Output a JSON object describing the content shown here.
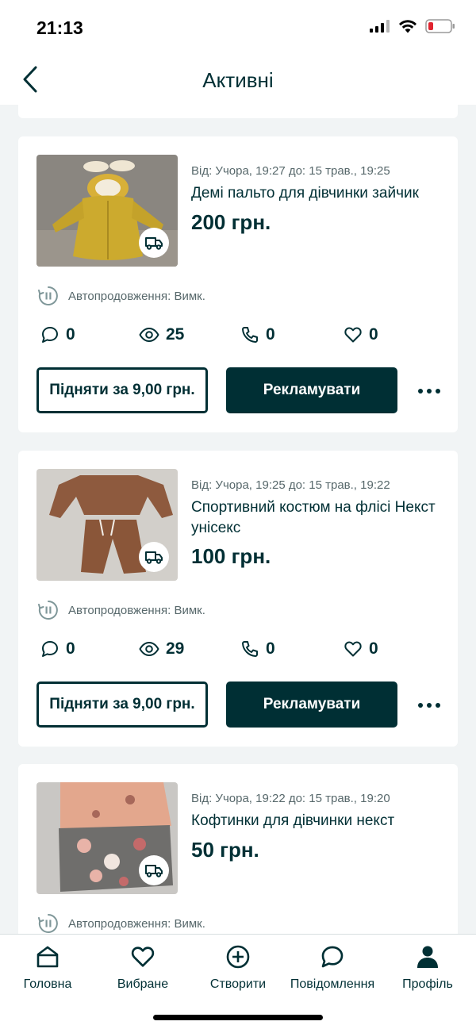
{
  "status_bar": {
    "time": "21:13"
  },
  "header": {
    "title": "Активні"
  },
  "ads": [
    {
      "dates": "Від: Учора, 19:27 до: 15 трав., 19:25",
      "title": "Демі пальто для дівчинки зайчик",
      "price": "200 грн.",
      "autorenew": "Автопродовження: Вимк.",
      "stats": {
        "messages": "0",
        "views": "25",
        "calls": "0",
        "favorites": "0"
      },
      "raise_label": "Підняти за 9,00 грн.",
      "promote_label": "Рекламувати"
    },
    {
      "dates": "Від: Учора, 19:25 до: 15 трав., 19:22",
      "title": "Спортивний костюм на флісі Некст унісекс",
      "price": "100 грн.",
      "autorenew": "Автопродовження: Вимк.",
      "stats": {
        "messages": "0",
        "views": "29",
        "calls": "0",
        "favorites": "0"
      },
      "raise_label": "Підняти за 9,00 грн.",
      "promote_label": "Рекламувати"
    },
    {
      "dates": "Від: Учора, 19:22 до: 15 трав., 19:20",
      "title": "Кофтинки для дівчинки некст",
      "price": "50 грн.",
      "autorenew": "Автопродовження: Вимк."
    }
  ],
  "tabs": [
    {
      "label": "Головна",
      "icon": "home-icon"
    },
    {
      "label": "Вибране",
      "icon": "heart-icon"
    },
    {
      "label": "Створити",
      "icon": "plus-circle-icon"
    },
    {
      "label": "Повідомлення",
      "icon": "chat-icon"
    },
    {
      "label": "Профіль",
      "icon": "profile-icon"
    }
  ],
  "colors": {
    "primary": "#002f34",
    "background": "#f1f4f5",
    "muted_text": "#57686b",
    "battery_low": "#e0242f"
  }
}
